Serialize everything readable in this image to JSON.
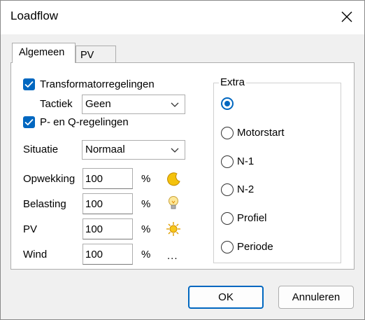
{
  "window": {
    "title": "Loadflow"
  },
  "tabs": [
    {
      "label": "Algemeen"
    },
    {
      "label": "PV"
    }
  ],
  "regelingen": {
    "transformator": {
      "label": "Transformatorregelingen",
      "checked": true
    },
    "tactiek": {
      "label": "Tactiek",
      "value": "Geen"
    },
    "pq": {
      "label": "P- en Q-regelingen",
      "checked": true
    }
  },
  "situatie": {
    "label": "Situatie",
    "value": "Normaal"
  },
  "profiles": [
    {
      "label": "Opwekking",
      "value": "100",
      "unit": "%",
      "icon": "moon-icon"
    },
    {
      "label": "Belasting",
      "value": "100",
      "unit": "%",
      "icon": "lightbulb-icon"
    },
    {
      "label": "PV",
      "value": "100",
      "unit": "%",
      "icon": "sun-icon"
    },
    {
      "label": "Wind",
      "value": "100",
      "unit": "%",
      "more": "..."
    }
  ],
  "extra": {
    "title": "Extra",
    "options": [
      {
        "label": "",
        "selected": true
      },
      {
        "label": "Motorstart",
        "selected": false
      },
      {
        "label": "N-1",
        "selected": false
      },
      {
        "label": "N-2",
        "selected": false
      },
      {
        "label": "Profiel",
        "selected": false
      },
      {
        "label": "Periode",
        "selected": false
      }
    ]
  },
  "buttons": {
    "ok": "OK",
    "cancel": "Annuleren"
  },
  "colors": {
    "accent": "#0067c0",
    "dialog_bg": "#f0f0f0"
  }
}
